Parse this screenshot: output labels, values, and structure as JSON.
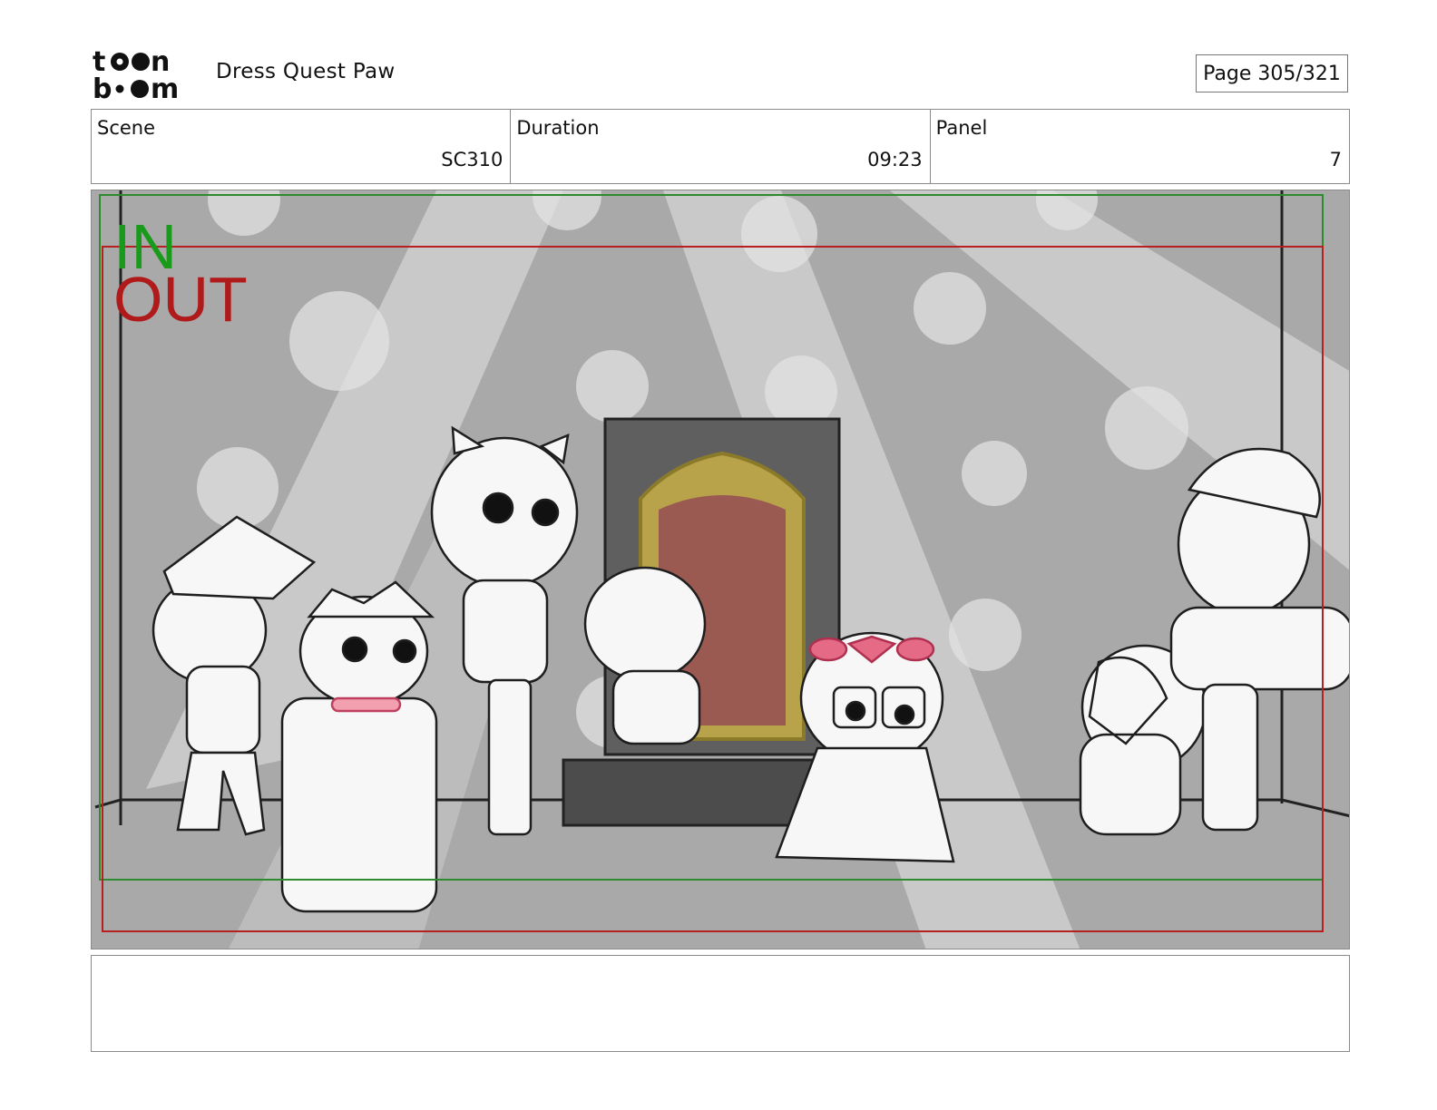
{
  "header": {
    "logo_text": "toon boom",
    "project_title": "Dress Quest Paw",
    "page_label": "Page 305/321"
  },
  "info": {
    "scene_label": "Scene",
    "scene_value": "SC310",
    "duration_label": "Duration",
    "duration_value": "09:23",
    "panel_label": "Panel",
    "panel_value": "7"
  },
  "panel": {
    "in_label": "IN",
    "out_label": "OUT",
    "in_color": "#1a9a1a",
    "out_color": "#b01a1a"
  },
  "notes": {
    "text": ""
  }
}
